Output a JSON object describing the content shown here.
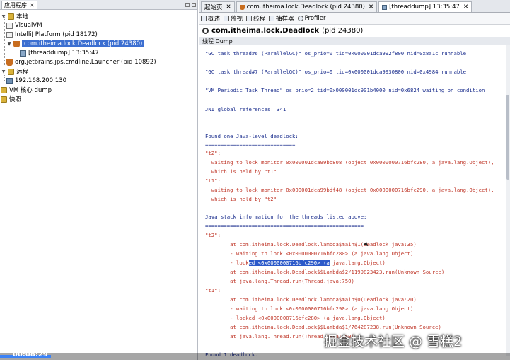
{
  "left_panel": {
    "tab_title": "应用程序",
    "tab_close": "✕",
    "tree": [
      {
        "label": "本地",
        "icon": "folder-icon"
      },
      {
        "label": "VisualVM",
        "icon": "app-icon"
      },
      {
        "label": "IntelliJ Platform (pid 18172)",
        "icon": "app-icon"
      },
      {
        "label": "com.itheima.lock.Deadlock (pid 24380)",
        "icon": "java-icon",
        "selected": true
      },
      {
        "label": "[threaddump] 13:35:47",
        "icon": "dump-icon"
      },
      {
        "label": "org.jetbrains.jps.cmdline.Launcher (pid 10892)",
        "icon": "java-icon"
      },
      {
        "label": "远程",
        "icon": "folder-icon"
      },
      {
        "label": "192.168.200.130",
        "icon": "host-icon"
      },
      {
        "label": "VM 核心 dump",
        "icon": "folder-icon"
      },
      {
        "label": "快照",
        "icon": "folder-icon"
      }
    ]
  },
  "editor_tabs": [
    {
      "label": "起始页",
      "close": "✕",
      "active": false
    },
    {
      "label": "com.itheima.lock.Deadlock (pid 24380)",
      "close": "✕",
      "active": false
    },
    {
      "label": "[threaddump] 13:35:47",
      "close": "✕",
      "active": true
    }
  ],
  "toolbar": [
    {
      "label": "概述",
      "icon": "overview-icon"
    },
    {
      "label": "监视",
      "icon": "monitor-icon"
    },
    {
      "label": "线程",
      "icon": "threads-icon"
    },
    {
      "label": "抽样器",
      "icon": "sampler-icon"
    },
    {
      "label": "Profiler",
      "icon": "profiler-icon"
    }
  ],
  "app_title": {
    "name": "com.itheima.lock.Deadlock",
    "pid": "(pid 24380)"
  },
  "subtab_label": "线程 Dump",
  "dump_lines": [
    {
      "t": "\"GC task thread#6 (ParallelGC)\" os_prio=0 tid=0x000001dca992f800 nid=0x8a1c runnable",
      "c": "blue"
    },
    {
      "t": "\"GC task thread#7 (ParallelGC)\" os_prio=0 tid=0x000001dca9930800 nid=0x4984 runnable",
      "c": "blue"
    },
    {
      "t": "\"VM Periodic Task Thread\" os_prio=2 tid=0x000001dc901b4000 nid=0x6824 waiting on condition",
      "c": "blue"
    },
    {
      "t": "JNI global references: 341",
      "c": "blue"
    },
    {
      "t": "Found one Java-level deadlock:",
      "c": "blue"
    },
    {
      "t": "=============================",
      "c": "blue"
    },
    {
      "t": "\"t2\":",
      "c": "red"
    },
    {
      "t": "  waiting to lock monitor 0x000001dca99bb808 (object 0x0000000716bfc280, a java.lang.Object),",
      "c": "red"
    },
    {
      "t": "  which is held by \"t1\"",
      "c": "red"
    },
    {
      "t": "\"t1\":",
      "c": "red"
    },
    {
      "t": "  waiting to lock monitor 0x000001dca99bdf48 (object 0x0000000716bfc290, a java.lang.Object),",
      "c": "red"
    },
    {
      "t": "  which is held by \"t2\"",
      "c": "red"
    },
    {
      "t": "Java stack information for the threads listed above:",
      "c": "blue"
    },
    {
      "t": "===================================================",
      "c": "blue"
    },
    {
      "t": "\"t2\":",
      "c": "red"
    },
    {
      "t": "        at com.itheima.lock.Deadlock.lambda$main$1(Deadlock.java:35)",
      "c": "red"
    },
    {
      "t": "        - waiting to lock <0x0000000716bfc280> (a java.lang.Object)",
      "c": "red"
    },
    {
      "t": "        - locked <0x0000000716bfc290> (a java.lang.Object)",
      "c": "red"
    },
    {
      "t": "        at com.itheima.lock.Deadlock$$Lambda$2/1199823423.run(Unknown Source)",
      "c": "red"
    },
    {
      "t": "        at java.lang.Thread.run(Thread.java:750)",
      "c": "red"
    },
    {
      "t": "\"t1\":",
      "c": "red"
    },
    {
      "t": "        at com.itheima.lock.Deadlock.lambda$main$0(Deadlock.java:20)",
      "c": "red"
    },
    {
      "t": "        - waiting to lock <0x0000000716bfc290> (a java.lang.Object)",
      "c": "red"
    },
    {
      "t": "        - locked <0x0000000716bfc280> (a java.lang.Object)",
      "c": "red"
    },
    {
      "t": "        at com.itheima.lock.Deadlock$$Lambda$1/764287238.run(Unknown Source)",
      "c": "red"
    },
    {
      "t": "        at java.lang.Thread.run(Thread.java:750)",
      "c": "red"
    },
    {
      "t": "Found 1 deadlock.",
      "c": "blue"
    }
  ],
  "highlight_segment": "ed <0x0000000716bfc290> (a",
  "video": {
    "timecode": "00:08:29",
    "progress": 0.1
  },
  "watermark": "掘金技术社区 @ 雪糕2",
  "colors": {
    "selection": "#3c6fd1",
    "dump_blue": "#1c2f8e",
    "dump_red": "#c0392b"
  }
}
